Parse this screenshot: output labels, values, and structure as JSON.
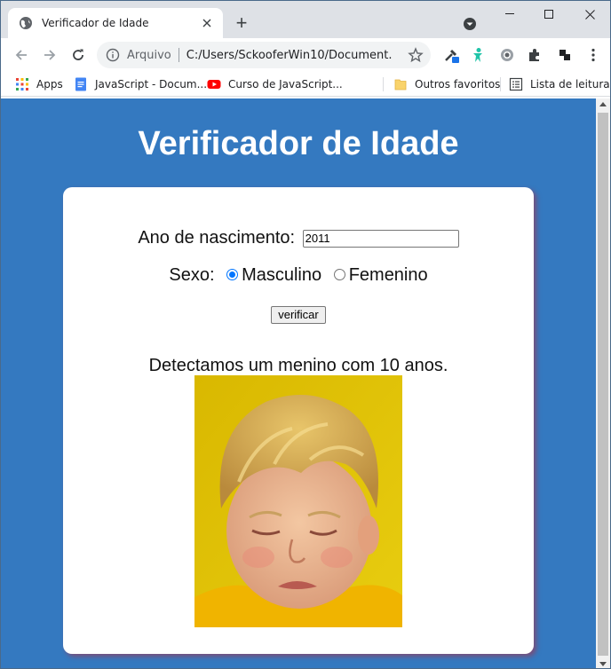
{
  "browser": {
    "tab_title": "Verificador de Idade",
    "new_tab": "+",
    "omnibox": {
      "scheme_label": "Arquivo",
      "url": "C:/Users/SckooferWin10/Document..."
    },
    "bookmarks": [
      {
        "label": "Apps",
        "icon": "apps-grid-icon"
      },
      {
        "label": "JavaScript - Docum...",
        "icon": "docs-icon"
      },
      {
        "label": "Curso de JavaScript...",
        "icon": "youtube-icon"
      },
      {
        "label": "Outros favoritos",
        "icon": "folder-icon"
      },
      {
        "label": "Lista de leitura",
        "icon": "reading-list-icon"
      }
    ]
  },
  "page": {
    "title": "Verificador de Idade",
    "birth_year": {
      "label": "Ano de nascimento:",
      "value": "2011"
    },
    "sex": {
      "label": "Sexo:",
      "options": [
        {
          "label": "Masculino",
          "checked": true
        },
        {
          "label": "Femenino",
          "checked": false
        }
      ]
    },
    "verify_button": "verificar",
    "result_text": "Detectamos um menino com 10 anos.",
    "result_image": "crying-boy-photo"
  },
  "colors": {
    "page_bg": "#3479c0",
    "title_text": "#ffffff",
    "card_bg": "#ffffff",
    "card_shadow": "#b4283c",
    "radio_accent": "#0075ff",
    "photo_bg": "#e2c200"
  }
}
